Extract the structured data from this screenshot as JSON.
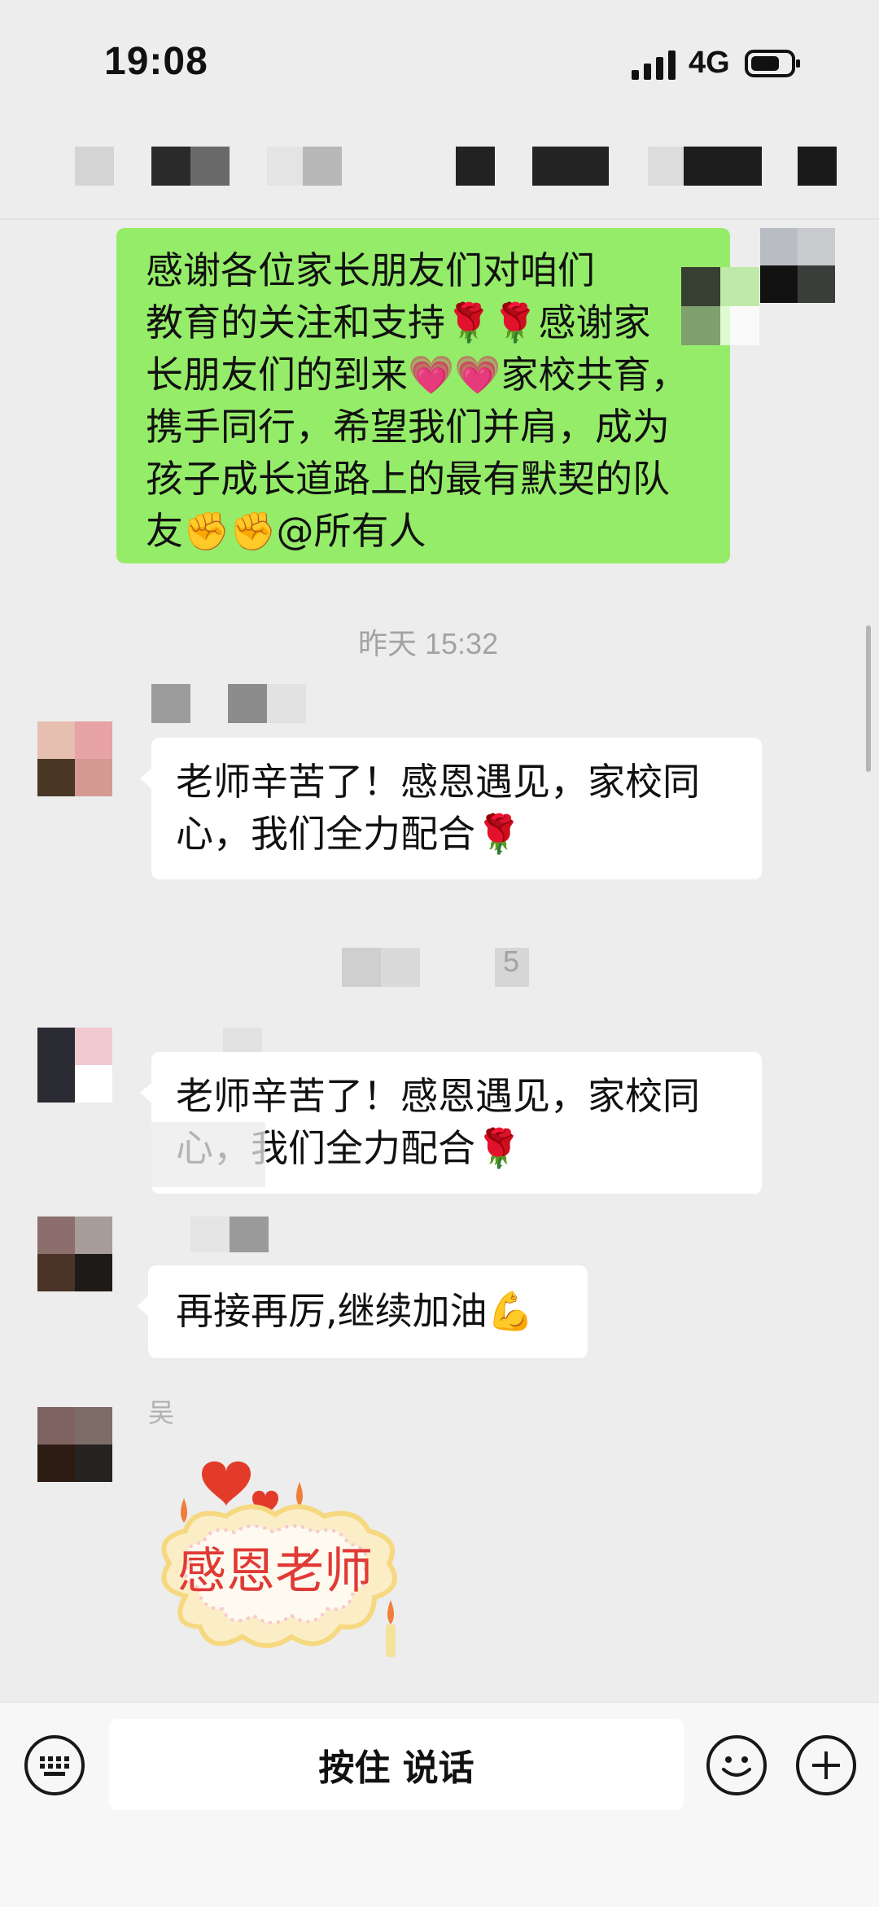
{
  "status_bar": {
    "time": "19:08",
    "network": "4G"
  },
  "messages": [
    {
      "id": "m1",
      "side": "right",
      "color": "#95ec69",
      "lines": [
        "感谢各位家长朋友们对咱们",
        "教育的关注和支持🌹🌹感谢家",
        "长朋友们的到来💗💗家校共育，",
        "携手同行，希望我们并肩，成为",
        "孩子成长道路上的最有默契的队",
        "友✊✊@所有人"
      ]
    },
    {
      "id": "m2",
      "side": "left",
      "text_lines": [
        "老师辛苦了！感恩遇见，家校同",
        "心，我们全力配合🌹"
      ]
    },
    {
      "id": "m3",
      "side": "left",
      "text_lines": [
        "老师辛苦了！感恩遇见，家校同",
        "心，我们全力配合🌹"
      ]
    },
    {
      "id": "m4",
      "side": "left",
      "text_lines": [
        "再接再厉,继续加油💪"
      ]
    },
    {
      "id": "m5",
      "side": "left",
      "sticker_text": "感恩老师"
    }
  ],
  "timestamps": {
    "t1": "昨天 15:32",
    "t2_visible_fragment": "5"
  },
  "sender_fragment": "吴",
  "input_bar": {
    "hold_to_talk_label": "按住 说话",
    "icons": [
      "keyboard-icon",
      "emoji-icon",
      "plus-icon"
    ]
  },
  "colors": {
    "background": "#ededed",
    "self_bubble": "#95ec69",
    "other_bubble": "#ffffff",
    "timestamp": "#a3a3a3"
  }
}
